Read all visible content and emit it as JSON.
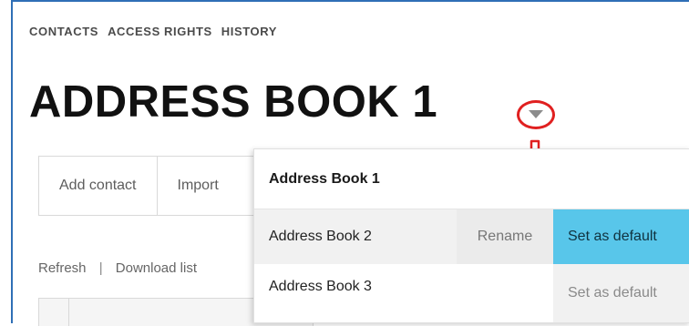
{
  "top_tabs": [
    "CONTACTS",
    "ACCESS RIGHTS",
    "HISTORY"
  ],
  "title": "ADDRESS BOOK 1",
  "icons": {
    "dropdown": "chevron-down-icon",
    "annotation": "arrow-down-icon"
  },
  "toolbar": {
    "add_contact": "Add contact",
    "import": "Import"
  },
  "links": {
    "refresh": "Refresh",
    "separator": "|",
    "download": "Download list"
  },
  "dropdown": {
    "current": "Address Book 1",
    "items": [
      {
        "name": "Address Book 2",
        "rename": "Rename",
        "set_default": "Set as default"
      },
      {
        "name": "Address Book 3",
        "set_default": "Set as default"
      }
    ]
  },
  "colors": {
    "accent": "#58c6ea",
    "annotation": "#e02020",
    "frame": "#2f6fb6"
  }
}
